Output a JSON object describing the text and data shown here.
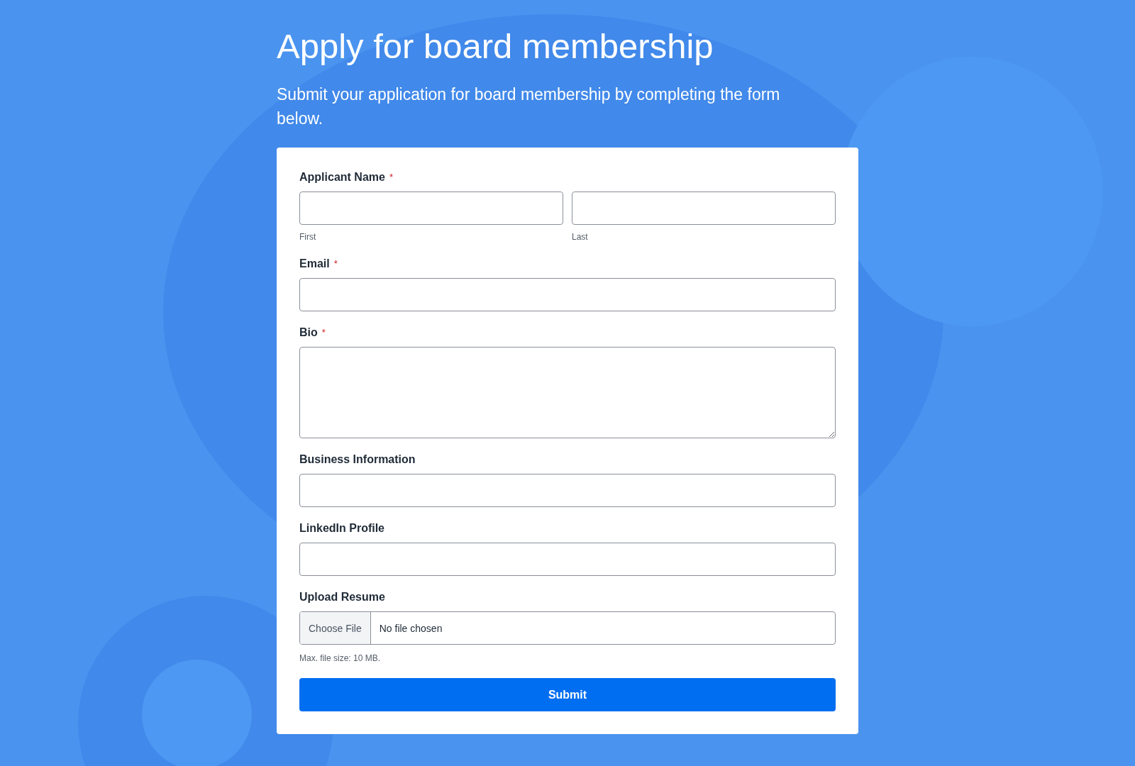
{
  "title": "Apply for board membership",
  "subtitle": "Submit your application for board membership by completing the form below.",
  "required_mark": "*",
  "fields": [
    {
      "kind": "name",
      "label": "Applicant Name",
      "required": true,
      "parts": [
        "First",
        "Last"
      ]
    },
    {
      "kind": "text",
      "label": "Email",
      "required": true
    },
    {
      "kind": "textarea",
      "label": "Bio",
      "required": true
    },
    {
      "kind": "text",
      "label": "Business Information",
      "required": false
    },
    {
      "kind": "text",
      "label": "LinkedIn Profile",
      "required": false
    },
    {
      "kind": "file",
      "label": "Upload Resume",
      "required": false,
      "button": "Choose File",
      "status": "No file chosen",
      "hint": "Max. file size: 10 MB."
    }
  ],
  "submit": "Submit"
}
